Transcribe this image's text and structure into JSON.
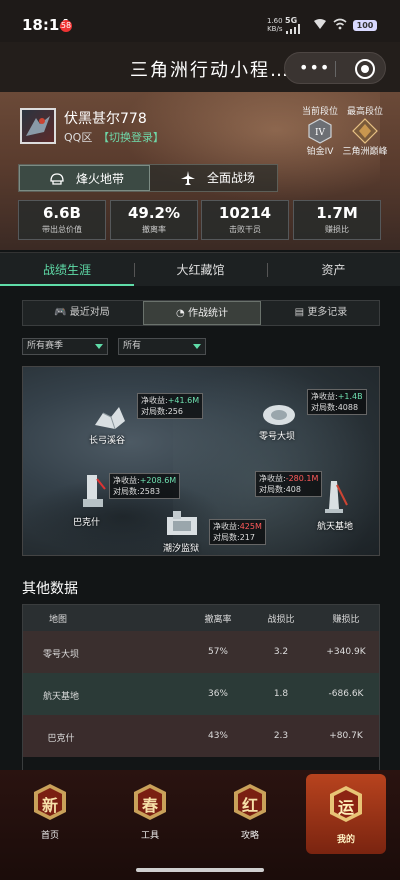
{
  "status": {
    "time": "18:14",
    "badge": "58",
    "net_speed": "1.60",
    "net_unit": "KB/s",
    "sig_label": "5G",
    "battery": "100"
  },
  "app": {
    "title": "三角洲行动小程…",
    "more": "•••"
  },
  "player": {
    "name": "伏黑甚尔778",
    "zone": "QQ区",
    "switch_label": "【切换登录】"
  },
  "ranks": {
    "current_label": "当前段位",
    "current_name": "铂金IV",
    "highest_label": "最高段位",
    "highest_name": "三角洲巅峰"
  },
  "modes": [
    {
      "label": "烽火地带",
      "icon": "helmet-icon"
    },
    {
      "label": "全面战场",
      "icon": "aircraft-icon"
    }
  ],
  "stats": [
    {
      "value": "6.6B",
      "label": "带出总价值"
    },
    {
      "value": "49.2%",
      "label": "撤离率"
    },
    {
      "value": "10214",
      "label": "击败干员"
    },
    {
      "value": "1.7M",
      "label": "赚损比"
    }
  ],
  "main_tabs": [
    "战绩生涯",
    "大红藏馆",
    "资产"
  ],
  "sub_tabs": [
    {
      "label": "最近对局",
      "icon": "gamepad-icon"
    },
    {
      "label": "作战统计",
      "icon": "pie-chart-icon"
    },
    {
      "label": "更多记录",
      "icon": "document-icon"
    }
  ],
  "filters": {
    "season": "所有赛季",
    "type": "所有"
  },
  "map_points": [
    {
      "name": "长弓溪谷",
      "income_label": "净收益:",
      "income": "+41.6M",
      "games_label": "对局数:",
      "games": "256",
      "sign": "pos"
    },
    {
      "name": "零号大坝",
      "income_label": "净收益:",
      "income": "+1.4B",
      "games_label": "对局数:",
      "games": "4088",
      "sign": "pos"
    },
    {
      "name": "巴克什",
      "income_label": "净收益:",
      "income": "+208.6M",
      "games_label": "对局数:",
      "games": "2583",
      "sign": "pos"
    },
    {
      "name": "航天基地",
      "income_label": "净收益:",
      "income": "-280.1M",
      "games_label": "对局数:",
      "games": "408",
      "sign": "neg"
    },
    {
      "name": "潮汐监狱",
      "income_label": "净收益:",
      "income": "425M",
      "games_label": "对局数:",
      "games": "217",
      "sign": "neg"
    }
  ],
  "other_data": {
    "title": "其他数据",
    "headers": [
      "地图",
      "撤离率",
      "战损比",
      "赚损比"
    ],
    "rows": [
      [
        "零号大坝",
        "57%",
        "3.2",
        "+340.9K"
      ],
      [
        "航天基地",
        "36%",
        "1.8",
        "-686.6K"
      ],
      [
        "巴克什",
        "43%",
        "2.3",
        "+80.7K"
      ]
    ]
  },
  "nav": [
    {
      "badge": "新",
      "label": "首页"
    },
    {
      "badge": "春",
      "label": "工具"
    },
    {
      "badge": "红",
      "label": "攻略"
    },
    {
      "badge": "运",
      "label": "我的"
    }
  ],
  "colors": {
    "accent": "#5fdca8",
    "negative": "#ff5a5a",
    "nav_bg": "#2a1310"
  }
}
